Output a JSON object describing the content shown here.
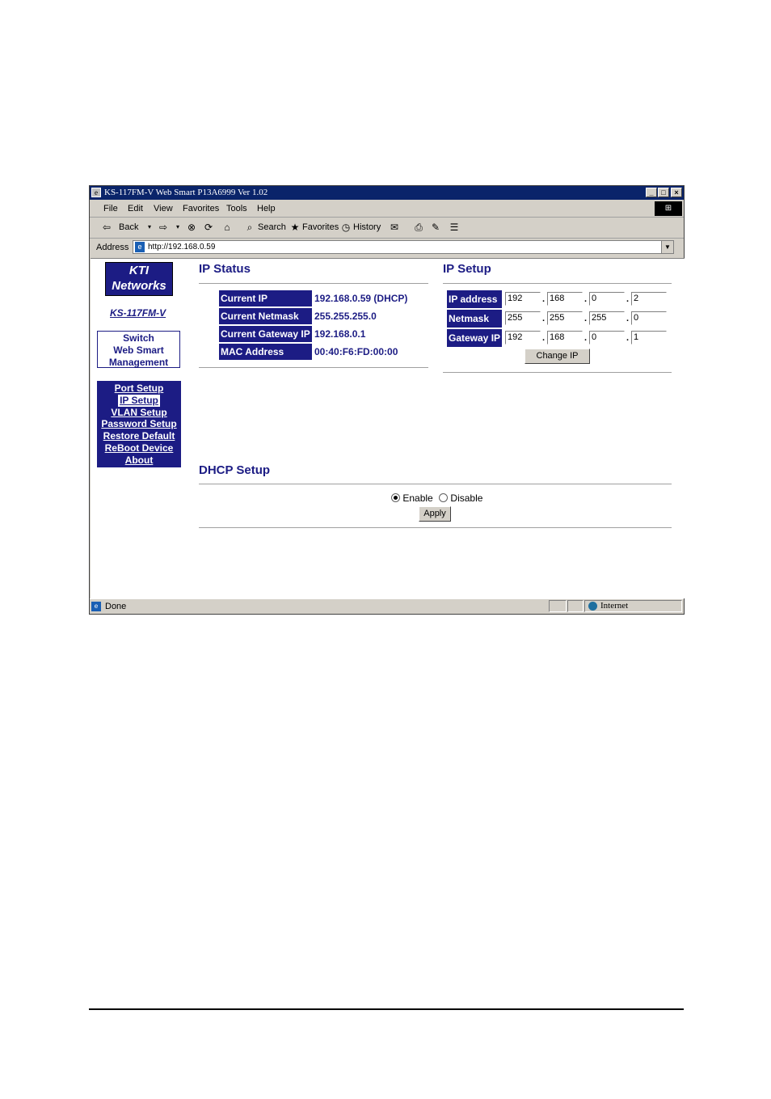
{
  "window": {
    "title": "KS-117FM-V  Web Smart P13A6999 Ver 1.02",
    "controls": [
      "_",
      "□",
      "×"
    ]
  },
  "menubar": [
    "File",
    "Edit",
    "View",
    "Favorites",
    "Tools",
    "Help"
  ],
  "toolbar": {
    "back": "Back",
    "search": "Search",
    "favorites": "Favorites",
    "history": "History"
  },
  "addressbar": {
    "label": "Address",
    "url": "http://192.168.0.59"
  },
  "sidebar": {
    "logo_line1": "KTI",
    "logo_line2": "Networks",
    "model": "KS-117FM-V",
    "switch_line1": "Switch",
    "switch_line2": "Web Smart",
    "switch_line3": "Management",
    "nav": [
      {
        "label": "Port Setup"
      },
      {
        "label": "IP Setup",
        "active": true
      },
      {
        "label": "VLAN Setup"
      },
      {
        "label": "Password Setup"
      },
      {
        "label": "Restore Default"
      },
      {
        "label": "ReBoot Device"
      },
      {
        "label": "About"
      }
    ]
  },
  "ip_status": {
    "title": "IP Status",
    "rows": [
      {
        "label": "Current IP",
        "value": "192.168.0.59 (DHCP)"
      },
      {
        "label": "Current Netmask",
        "value": "255.255.255.0"
      },
      {
        "label": "Current Gateway IP",
        "value": "192.168.0.1"
      },
      {
        "label": "MAC Address",
        "value": "00:40:F6:FD:00:00"
      }
    ]
  },
  "ip_setup": {
    "title": "IP Setup",
    "rows": [
      {
        "label": "IP address",
        "octets": [
          "192",
          "168",
          "0",
          "2"
        ]
      },
      {
        "label": "Netmask",
        "octets": [
          "255",
          "255",
          "255",
          "0"
        ]
      },
      {
        "label": "Gateway IP",
        "octets": [
          "192",
          "168",
          "0",
          "1"
        ]
      }
    ],
    "button": "Change IP"
  },
  "dhcp_setup": {
    "title": "DHCP Setup",
    "enable_label": "Enable",
    "disable_label": "Disable",
    "selected": "Enable",
    "apply_button": "Apply"
  },
  "statusbar": {
    "status": "Done",
    "zone": "Internet"
  },
  "colors": {
    "navy": "#1c1c84",
    "titlebar": "#0a246a",
    "chrome": "#d4d0c8"
  }
}
